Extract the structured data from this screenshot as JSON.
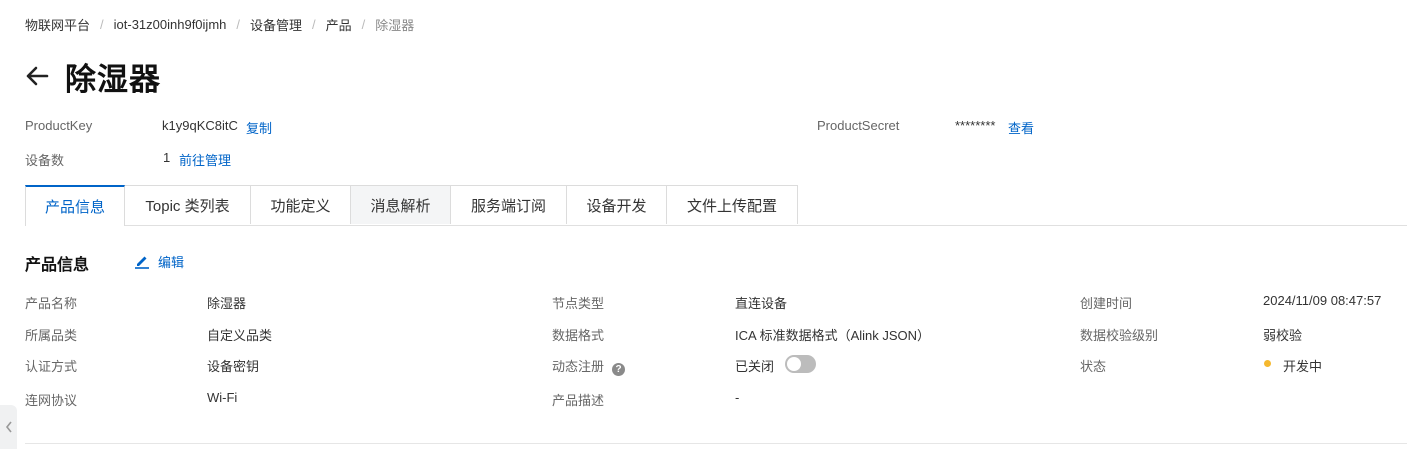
{
  "breadcrumb": {
    "items": [
      "物联网平台",
      "iot-31z00inh9f0ijmh",
      "设备管理",
      "产品",
      "除湿器"
    ],
    "separator": "/"
  },
  "page": {
    "title": "除湿器"
  },
  "summary": {
    "product_key_label": "ProductKey",
    "product_key_value": "k1y9qKC8itC",
    "copy_label": "复制",
    "product_secret_label": "ProductSecret",
    "product_secret_value": "********",
    "view_label": "查看",
    "device_count_label": "设备数",
    "device_count_value": "1",
    "manage_label": "前往管理"
  },
  "tabs": [
    {
      "label": "产品信息",
      "active": true
    },
    {
      "label": "Topic 类列表"
    },
    {
      "label": "功能定义"
    },
    {
      "label": "消息解析"
    },
    {
      "label": "服务端订阅"
    },
    {
      "label": "设备开发"
    },
    {
      "label": "文件上传配置"
    }
  ],
  "section": {
    "title": "产品信息",
    "edit_label": "编辑"
  },
  "info": {
    "product_name_label": "产品名称",
    "product_name": "除湿器",
    "category_label": "所属品类",
    "category": "自定义品类",
    "auth_label": "认证方式",
    "auth": "设备密钥",
    "protocol_label": "连网协议",
    "protocol": "Wi-Fi",
    "node_type_label": "节点类型",
    "node_type": "直连设备",
    "data_format_label": "数据格式",
    "data_format": "ICA 标准数据格式（Alink JSON）",
    "dynamic_reg_label": "动态注册",
    "dynamic_reg_state": "已关闭",
    "desc_label": "产品描述",
    "desc": "-",
    "created_label": "创建时间",
    "created": "2024/11/09 08:47:57",
    "check_level_label": "数据校验级别",
    "check_level": "弱校验",
    "status_label": "状态",
    "status": "开发中"
  },
  "colors": {
    "accent": "#0064c8",
    "status_dot": "#f5b82e",
    "toggle_off": "#bcbcbc"
  },
  "icons": {
    "back": "arrow-left-icon",
    "edit": "pencil-icon",
    "help": "question-circle-icon",
    "side": "chevron-left-icon"
  }
}
